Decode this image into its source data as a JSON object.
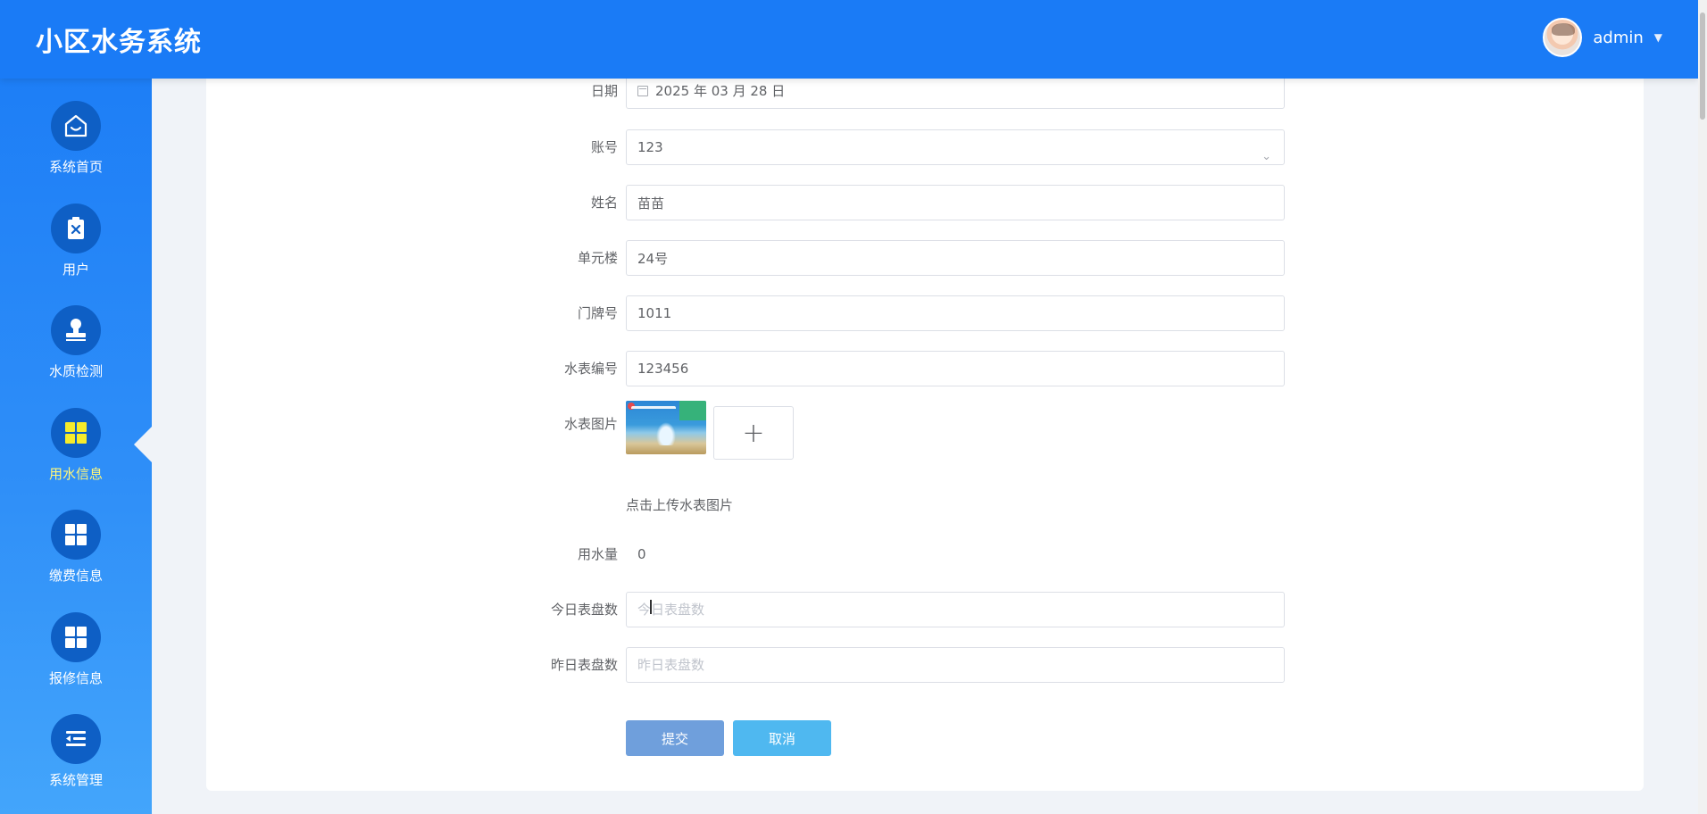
{
  "header": {
    "app_title": "小区水务系统",
    "username": "admin"
  },
  "sidebar": {
    "items": [
      {
        "label": "系统首页",
        "icon": "home-icon"
      },
      {
        "label": "用户",
        "icon": "clipboard-x-icon"
      },
      {
        "label": "水质检测",
        "icon": "stamp-icon"
      },
      {
        "label": "用水信息",
        "icon": "grid-icon",
        "active": true
      },
      {
        "label": "缴费信息",
        "icon": "grid-icon"
      },
      {
        "label": "报修信息",
        "icon": "grid-icon"
      },
      {
        "label": "系统管理",
        "icon": "list-icon"
      }
    ],
    "active_color": "#fff77a"
  },
  "form": {
    "date": {
      "label": "日期",
      "value": "2025 年 03 月 28 日"
    },
    "account": {
      "label": "账号",
      "value": "123"
    },
    "name": {
      "label": "姓名",
      "value": "苗苗"
    },
    "building": {
      "label": "单元楼",
      "value": "24号"
    },
    "door_number": {
      "label": "门牌号",
      "value": "1011"
    },
    "meter_number": {
      "label": "水表编号",
      "value": "123456"
    },
    "meter_image": {
      "label": "水表图片",
      "upload_plus": "+",
      "upload_tip": "点击上传水表图片"
    },
    "water_usage": {
      "label": "用水量",
      "value": "0"
    },
    "today_reading": {
      "label": "今日表盘数",
      "placeholder": "今日表盘数",
      "value": ""
    },
    "yesterday_reading": {
      "label": "昨日表盘数",
      "placeholder": "昨日表盘数",
      "value": ""
    },
    "submit_label": "提交",
    "cancel_label": "取消"
  },
  "colors": {
    "header_bg": "#1a7bf6",
    "submit_bg": "#6f9fdc",
    "cancel_bg": "#4fb8f0"
  }
}
